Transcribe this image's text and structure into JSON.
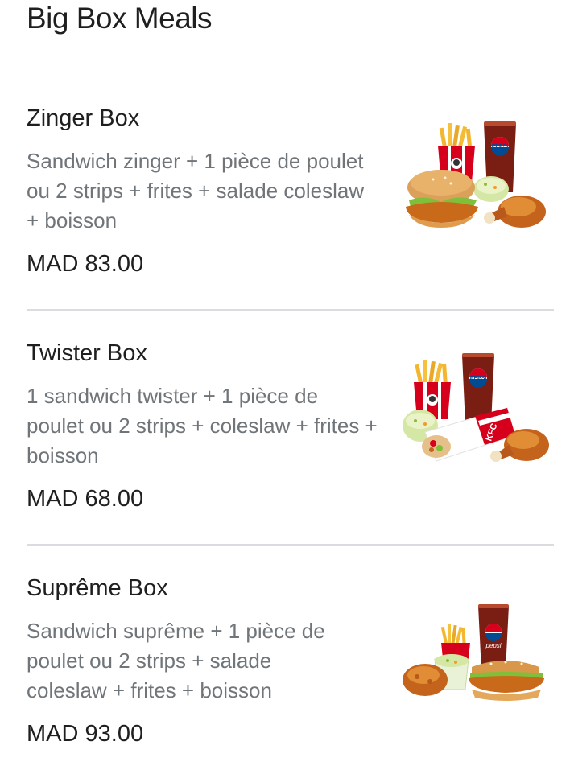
{
  "section": {
    "title": "Big Box Meals"
  },
  "items": [
    {
      "name": "Zinger Box",
      "description": "Sandwich zinger + 1 pièce de poulet ou 2 strips + frites + salade coleslaw + boisson",
      "price": "MAD 83.00",
      "image_icon": "zinger-box-meal-photo",
      "cup_label": "PEPSI"
    },
    {
      "name": "Twister Box",
      "description": "1 sandwich twister + 1 pièce de poulet ou 2 strips + coleslaw + frites + boisson",
      "price": "MAD 68.00",
      "image_icon": "twister-box-meal-photo",
      "cup_label": "PEPSI",
      "wrap_label": "KFC"
    },
    {
      "name": "Suprême Box",
      "description": "Sandwich suprême + 1 pièce de poulet ou 2 strips + salade coleslaw + frites + boisson",
      "price": "MAD 93.00",
      "image_icon": "supreme-box-meal-photo",
      "cup_label": "pepsi"
    }
  ],
  "colors": {
    "title": "#1f1f1f",
    "description": "#70757a",
    "divider": "#dadce0",
    "kfc_red": "#d6001c",
    "pepsi_blue": "#004b93"
  }
}
